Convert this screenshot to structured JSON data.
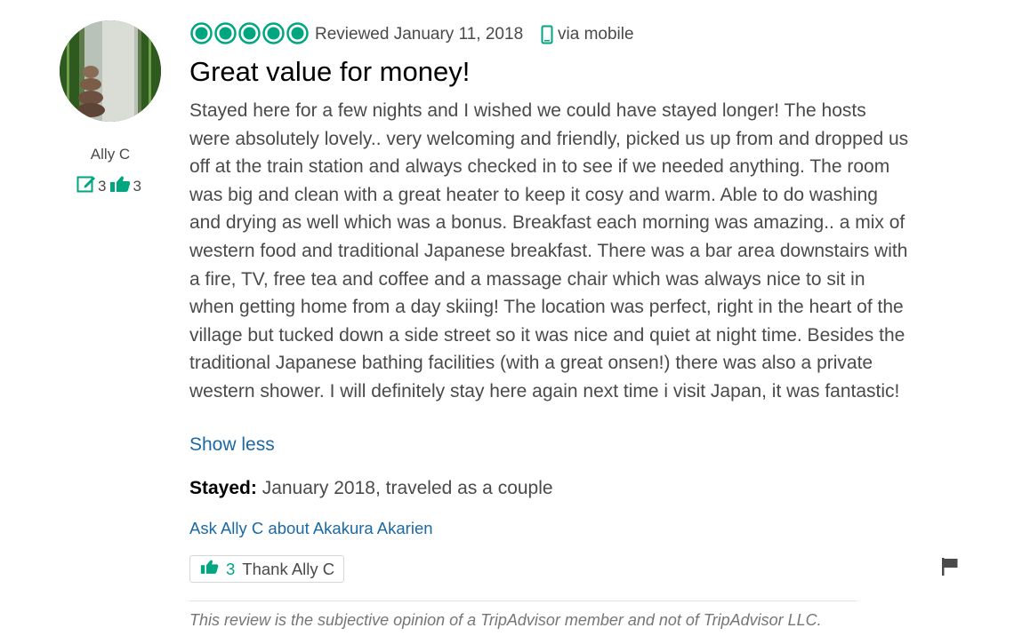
{
  "reviewer": {
    "name": "Ally C",
    "reviews_count": "3",
    "helpful_votes": "3"
  },
  "review": {
    "rating": 5,
    "rating_max": 5,
    "reviewed_date": "Reviewed January 11, 2018",
    "via": "via mobile",
    "title": "Great value for money!",
    "body": "Stayed here for a few nights and I wished we could have stayed longer! The hosts were absolutely lovely.. very welcoming and friendly, picked us up from and dropped us off at the train station and always checked in to see if we needed anything. The room was big and clean with a great heater to keep it cosy and warm. Able to do washing and drying as well which was a bonus. Breakfast each morning was amazing.. a mix of western food and traditional Japanese breakfast. There was a bar area downstairs with a fire, TV, free tea and coffee and a massage chair which was always nice to sit in when getting home from a day skiing! The location was perfect, right in the heart of the village but tucked down a side street so it was nice and quiet at night time. Besides the traditional Japanese bathing facilities (with a great onsen!) there was also a private western shower. I will definitely stay here again next time i visit Japan, it was fantastic!",
    "show_less": "Show less",
    "stayed_label": "Stayed:",
    "stayed_value": " January 2018, traveled as a couple",
    "ask_link": "Ask Ally C about Akakura Akarien",
    "thank_count": "3",
    "thank_label": "Thank Ally C",
    "disclaimer": "This review is the subjective opinion of a TripAdvisor member and not of TripAdvisor LLC."
  },
  "colors": {
    "brand_green": "#00a680",
    "link_blue": "#1a69a5",
    "text_gray": "#4a4a4a"
  },
  "icons": {
    "rating": "bubble-rating-icon",
    "mobile": "mobile-phone-icon",
    "reviews": "edit-review-icon",
    "helpful": "thumbs-up-icon",
    "flag": "flag-icon"
  }
}
